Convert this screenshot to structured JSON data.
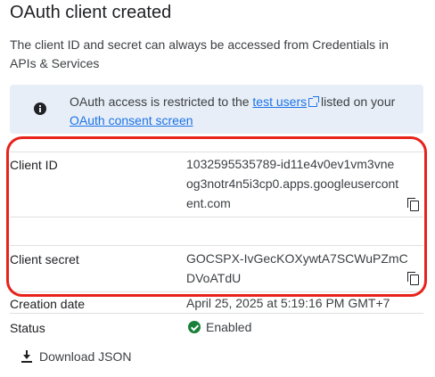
{
  "dialog": {
    "title": "OAuth client created",
    "description": "The client ID and secret can always be accessed from Credentials in APIs & Services"
  },
  "notice": {
    "icon": "info-icon",
    "text_before": "OAuth access is restricted to the ",
    "link1": "test users",
    "text_middle": " listed on your ",
    "link2": "OAuth consent screen"
  },
  "fields": {
    "client_id": {
      "label": "Client ID",
      "value": "1032595535789-id11e4v0ev1vm3vneog3notr4n5i3cp0.apps.googleusercontent.com"
    },
    "client_secret": {
      "label": "Client secret",
      "value": "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"
    },
    "creation_date": {
      "label": "Creation date",
      "value": "April 25, 2025 at 5:19:16 PM GMT+7"
    },
    "status": {
      "label": "Status",
      "value": "Enabled"
    }
  },
  "actions": {
    "download_label": "Download JSON"
  },
  "colors": {
    "accent": "#1a73e8",
    "highlight": "#e8221b",
    "status_ok": "#188038",
    "notice_bg": "#e8eef7"
  }
}
